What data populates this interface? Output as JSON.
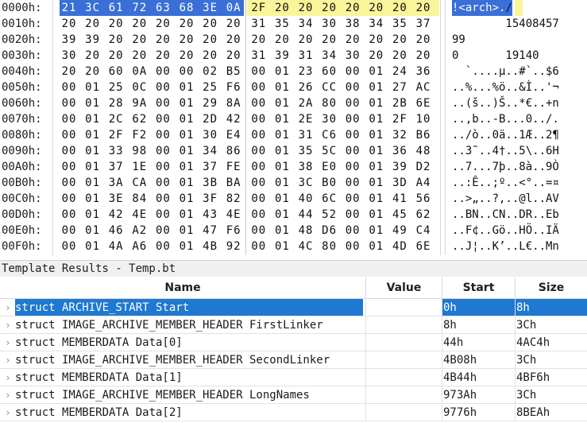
{
  "hex_rows": [
    {
      "addr": "0000h:",
      "bytes": [
        "21",
        "3C",
        "61",
        "72",
        "63",
        "68",
        "3E",
        "0A",
        "2F",
        "20",
        "20",
        "20",
        "20",
        "20",
        "20",
        "20"
      ],
      "ascii": "!<arch>./"
    },
    {
      "addr": "0010h:",
      "bytes": [
        "20",
        "20",
        "20",
        "20",
        "20",
        "20",
        "20",
        "20",
        "31",
        "35",
        "34",
        "30",
        "38",
        "34",
        "35",
        "37"
      ],
      "ascii": "        15408457"
    },
    {
      "addr": "0020h:",
      "bytes": [
        "39",
        "39",
        "20",
        "20",
        "20",
        "20",
        "20",
        "20",
        "20",
        "20",
        "20",
        "20",
        "20",
        "20",
        "20",
        "20"
      ],
      "ascii": "99"
    },
    {
      "addr": "0030h:",
      "bytes": [
        "30",
        "20",
        "20",
        "20",
        "20",
        "20",
        "20",
        "20",
        "31",
        "39",
        "31",
        "34",
        "30",
        "20",
        "20",
        "20"
      ],
      "ascii": "0       19140"
    },
    {
      "addr": "0040h:",
      "bytes": [
        "20",
        "20",
        "60",
        "0A",
        "00",
        "00",
        "02",
        "B5",
        "00",
        "01",
        "23",
        "60",
        "00",
        "01",
        "24",
        "36"
      ],
      "ascii": "  `....µ..#`..$6"
    },
    {
      "addr": "0050h:",
      "bytes": [
        "00",
        "01",
        "25",
        "0C",
        "00",
        "01",
        "25",
        "F6",
        "00",
        "01",
        "26",
        "CC",
        "00",
        "01",
        "27",
        "AC"
      ],
      "ascii": "..%...%ö..&Ì..'¬"
    },
    {
      "addr": "0060h:",
      "bytes": [
        "00",
        "01",
        "28",
        "9A",
        "00",
        "01",
        "29",
        "8A",
        "00",
        "01",
        "2A",
        "80",
        "00",
        "01",
        "2B",
        "6E"
      ],
      "ascii": "..(š..)Š..*€..+n"
    },
    {
      "addr": "0070h:",
      "bytes": [
        "00",
        "01",
        "2C",
        "62",
        "00",
        "01",
        "2D",
        "42",
        "00",
        "01",
        "2E",
        "30",
        "00",
        "01",
        "2F",
        "10"
      ],
      "ascii": "..,b..-B...0../."
    },
    {
      "addr": "0080h:",
      "bytes": [
        "00",
        "01",
        "2F",
        "F2",
        "00",
        "01",
        "30",
        "E4",
        "00",
        "01",
        "31",
        "C6",
        "00",
        "01",
        "32",
        "B6"
      ],
      "ascii": "../ò..0ä..1Æ..2¶"
    },
    {
      "addr": "0090h:",
      "bytes": [
        "00",
        "01",
        "33",
        "98",
        "00",
        "01",
        "34",
        "86",
        "00",
        "01",
        "35",
        "5C",
        "00",
        "01",
        "36",
        "48"
      ],
      "ascii": "..3˜..4†..5\\..6H"
    },
    {
      "addr": "00A0h:",
      "bytes": [
        "00",
        "01",
        "37",
        "1E",
        "00",
        "01",
        "37",
        "FE",
        "00",
        "01",
        "38",
        "E0",
        "00",
        "01",
        "39",
        "D2"
      ],
      "ascii": "..7...7þ..8à..9Ò"
    },
    {
      "addr": "00B0h:",
      "bytes": [
        "00",
        "01",
        "3A",
        "CA",
        "00",
        "01",
        "3B",
        "BA",
        "00",
        "01",
        "3C",
        "B0",
        "00",
        "01",
        "3D",
        "A4"
      ],
      "ascii": "..:Ê..;º..<°..=¤"
    },
    {
      "addr": "00C0h:",
      "bytes": [
        "00",
        "01",
        "3E",
        "84",
        "00",
        "01",
        "3F",
        "82",
        "00",
        "01",
        "40",
        "6C",
        "00",
        "01",
        "41",
        "56"
      ],
      "ascii": "..>„..?‚..@l..AV"
    },
    {
      "addr": "00D0h:",
      "bytes": [
        "00",
        "01",
        "42",
        "4E",
        "00",
        "01",
        "43",
        "4E",
        "00",
        "01",
        "44",
        "52",
        "00",
        "01",
        "45",
        "62"
      ],
      "ascii": "..BN..CN..DR..Eb"
    },
    {
      "addr": "00E0h:",
      "bytes": [
        "00",
        "01",
        "46",
        "A2",
        "00",
        "01",
        "47",
        "F6",
        "00",
        "01",
        "48",
        "D6",
        "00",
        "01",
        "49",
        "C4"
      ],
      "ascii": "..F¢..Gö..HÖ..IÄ"
    },
    {
      "addr": "00F0h:",
      "bytes": [
        "00",
        "01",
        "4A",
        "A6",
        "00",
        "01",
        "4B",
        "92",
        "00",
        "01",
        "4C",
        "80",
        "00",
        "01",
        "4D",
        "6E"
      ],
      "ascii": "..J¦..K’..L€..Mn"
    }
  ],
  "template": {
    "title": "Template Results - Temp.bt",
    "columns": {
      "name": "Name",
      "value": "Value",
      "start": "Start",
      "size": "Size"
    },
    "rows": [
      {
        "name": "struct ARCHIVE_START Start",
        "value": "",
        "start": "0h",
        "size": "8h",
        "selected": true
      },
      {
        "name": "struct IMAGE_ARCHIVE_MEMBER_HEADER FirstLinker",
        "value": "",
        "start": "8h",
        "size": "3Ch"
      },
      {
        "name": "struct MEMBERDATA Data[0]",
        "value": "",
        "start": "44h",
        "size": "4AC4h"
      },
      {
        "name": "struct IMAGE_ARCHIVE_MEMBER_HEADER SecondLinker",
        "value": "",
        "start": "4B08h",
        "size": "3Ch"
      },
      {
        "name": "struct MEMBERDATA Data[1]",
        "value": "",
        "start": "4B44h",
        "size": "4BF6h"
      },
      {
        "name": "struct IMAGE_ARCHIVE_MEMBER_HEADER LongNames",
        "value": "",
        "start": "973Ah",
        "size": "3Ch"
      },
      {
        "name": "struct MEMBERDATA Data[2]",
        "value": "",
        "start": "9776h",
        "size": "8BEAh"
      }
    ]
  },
  "colors": {
    "selection": "#3a6fd8",
    "highlight": "#fbf59a",
    "row_selected": "#1f78d1"
  }
}
